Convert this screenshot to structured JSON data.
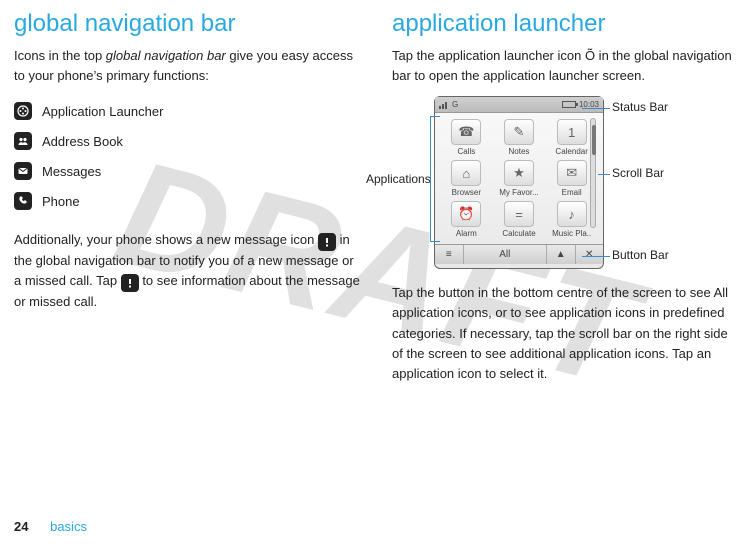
{
  "watermark": "DRAFT",
  "left": {
    "heading": "global navigation bar",
    "intro_a": "Icons in the top ",
    "intro_em": "global navigation bar",
    "intro_b": " give you easy access to your phone’s primary functions:",
    "items": [
      {
        "label": "Application Launcher"
      },
      {
        "label": "Address Book"
      },
      {
        "label": "Messages"
      },
      {
        "label": "Phone"
      }
    ],
    "para2_a": "Additionally, your phone shows a new message icon ",
    "para2_b": " in the global navigation bar to notify you of a new message or a missed call. Tap ",
    "para2_c": " to see information about the message or missed call."
  },
  "right": {
    "heading": "application launcher",
    "intro": "Tap the application launcher icon Õ in the global navigation bar to open the application launcher screen.",
    "phone": {
      "status_left": "G",
      "status_right": "10:03",
      "apps": [
        {
          "label": "Calls",
          "glyph": "☎"
        },
        {
          "label": "Notes",
          "glyph": "✎"
        },
        {
          "label": "Calendar",
          "glyph": "1"
        },
        {
          "label": "Browser",
          "glyph": "⌂"
        },
        {
          "label": "My Favor...",
          "glyph": "★"
        },
        {
          "label": "Email",
          "glyph": "✉"
        },
        {
          "label": "Alarm",
          "glyph": "⏰"
        },
        {
          "label": "Calculate",
          "glyph": "="
        },
        {
          "label": "Music Pla..",
          "glyph": "♪"
        }
      ],
      "buttonbar_menu": "≡",
      "buttonbar_all": "All",
      "buttonbar_up": "▲",
      "buttonbar_close": "✕"
    },
    "callouts": {
      "status_bar": "Status Bar",
      "scroll_bar": "Scroll Bar",
      "button_bar": "Button Bar",
      "applications": "Applications"
    },
    "para2": "Tap the button in the bottom centre of the screen to see All application icons, or to see application icons in predefined categories. If necessary, tap the scroll bar on the right side of the screen to see additional application icons. Tap an application icon to select it."
  },
  "footer": {
    "page": "24",
    "section": "basics"
  }
}
